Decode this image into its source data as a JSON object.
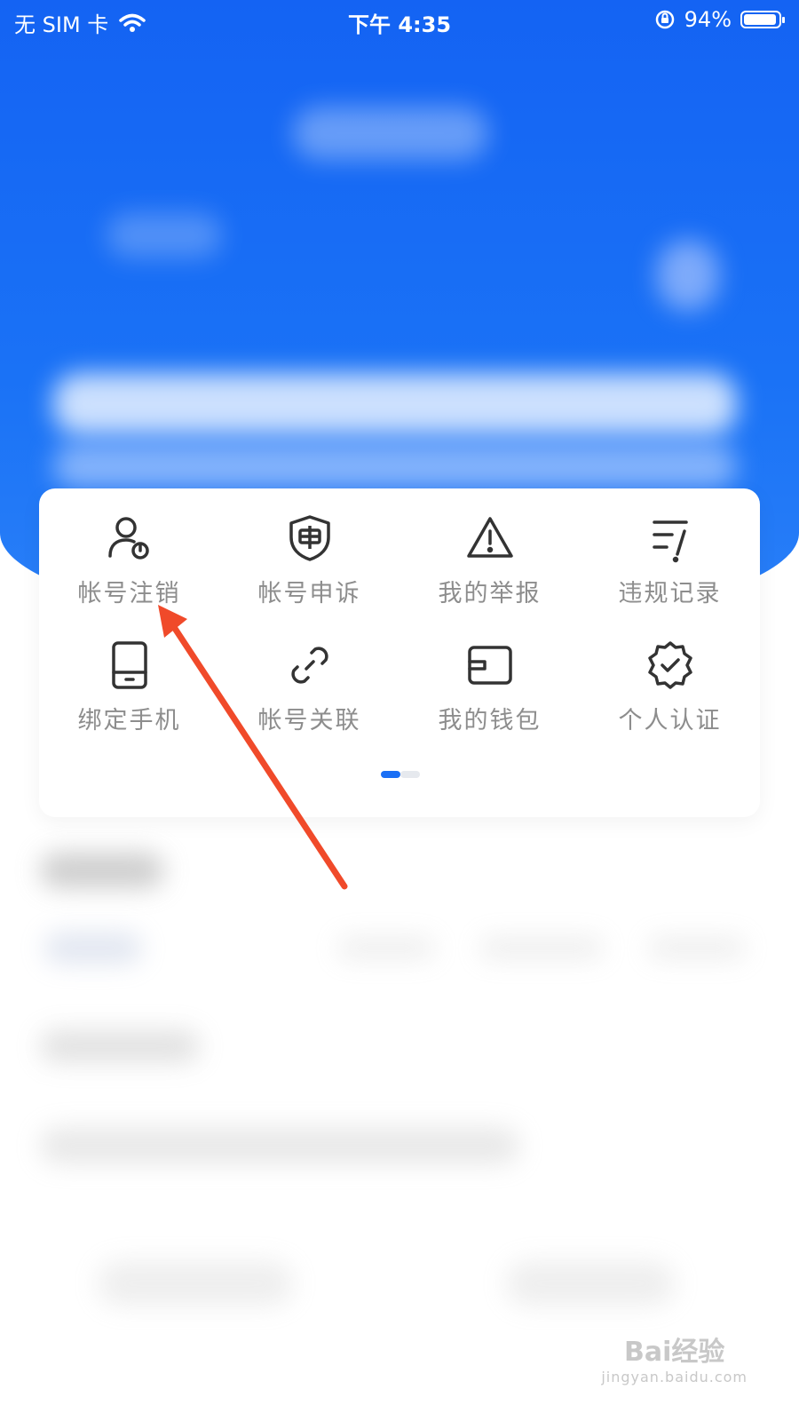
{
  "status_bar": {
    "carrier": "无 SIM 卡",
    "time": "下午 4:35",
    "battery_percent": "94%",
    "battery_level": 0.94
  },
  "menu": {
    "items": [
      {
        "label": "帐号注销",
        "icon": "user-power-icon"
      },
      {
        "label": "帐号申诉",
        "icon": "shield-appeal-icon"
      },
      {
        "label": "我的举报",
        "icon": "warning-triangle-icon"
      },
      {
        "label": "违规记录",
        "icon": "list-record-icon"
      },
      {
        "label": "绑定手机",
        "icon": "phone-icon"
      },
      {
        "label": "帐号关联",
        "icon": "link-icon"
      },
      {
        "label": "我的钱包",
        "icon": "wallet-icon"
      },
      {
        "label": "个人认证",
        "icon": "verified-badge-icon"
      }
    ],
    "page_indicator": {
      "current": 1,
      "total": 2
    }
  },
  "colors": {
    "primary": "#1a6ff5",
    "label": "#8d8d8d",
    "annotation_arrow": "#f04a2a"
  },
  "watermark": {
    "brand": "Bai经验",
    "url": "jingyan.baidu.com"
  }
}
